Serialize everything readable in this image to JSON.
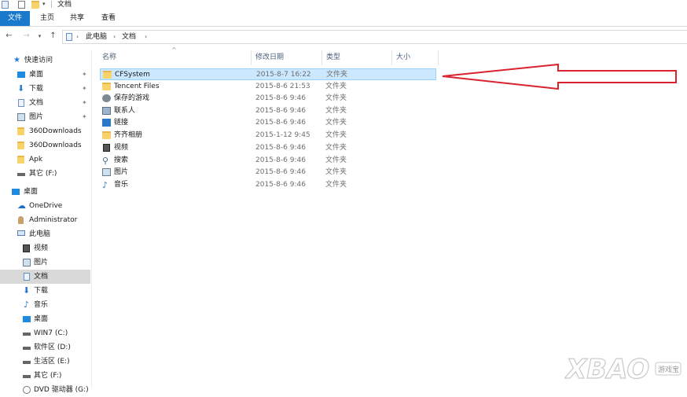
{
  "window": {
    "title": "文档"
  },
  "ribbon": {
    "tabs": [
      "文件",
      "主页",
      "共享",
      "查看"
    ]
  },
  "address": {
    "crumbs": [
      "此电脑",
      "文档"
    ]
  },
  "nav": {
    "items": [
      {
        "label": "快速访问"
      },
      {
        "label": "桌面"
      },
      {
        "label": "下载"
      },
      {
        "label": "文档"
      },
      {
        "label": "图片"
      },
      {
        "label": "360Downloads"
      },
      {
        "label": "360Downloads"
      },
      {
        "label": "Apk"
      },
      {
        "label": "其它 (F:)"
      },
      {
        "label": "桌面"
      },
      {
        "label": "OneDrive"
      },
      {
        "label": "Administrator"
      },
      {
        "label": "此电脑"
      },
      {
        "label": "视频"
      },
      {
        "label": "图片"
      },
      {
        "label": "文档"
      },
      {
        "label": "下载"
      },
      {
        "label": "音乐"
      },
      {
        "label": "桌面"
      },
      {
        "label": "WIN7 (C:)"
      },
      {
        "label": "软件区 (D:)"
      },
      {
        "label": "生活区 (E:)"
      },
      {
        "label": "其它 (F:)"
      },
      {
        "label": "DVD 驱动器 (G:)"
      }
    ]
  },
  "columns": {
    "name": "名称",
    "date": "修改日期",
    "type": "类型",
    "size": "大小"
  },
  "files": [
    {
      "name": "CFSystem",
      "date": "2015-8-7 16:22",
      "type": "文件夹",
      "icon": "folder-icon"
    },
    {
      "name": "Tencent Files",
      "date": "2015-8-6 21:53",
      "type": "文件夹",
      "icon": "folder-icon"
    },
    {
      "name": "保存的游戏",
      "date": "2015-8-6 9:46",
      "type": "文件夹",
      "icon": "saved-games-icon"
    },
    {
      "name": "联系人",
      "date": "2015-8-6 9:46",
      "type": "文件夹",
      "icon": "contacts-icon"
    },
    {
      "name": "链接",
      "date": "2015-8-6 9:46",
      "type": "文件夹",
      "icon": "links-icon"
    },
    {
      "name": "齐齐相册",
      "date": "2015-1-12 9:45",
      "type": "文件夹",
      "icon": "folder-icon"
    },
    {
      "name": "视频",
      "date": "2015-8-6 9:46",
      "type": "文件夹",
      "icon": "videos-icon"
    },
    {
      "name": "搜索",
      "date": "2015-8-6 9:46",
      "type": "文件夹",
      "icon": "search-icon"
    },
    {
      "name": "图片",
      "date": "2015-8-6 9:46",
      "type": "文件夹",
      "icon": "pictures-icon"
    },
    {
      "name": "音乐",
      "date": "2015-8-6 9:46",
      "type": "文件夹",
      "icon": "music-icon"
    }
  ],
  "watermark": {
    "text": "XBAO",
    "sub": "游戏宝"
  },
  "colors": {
    "accent": "#1979ca",
    "selection": "#cce8ff",
    "annotation": "#d9232e"
  }
}
